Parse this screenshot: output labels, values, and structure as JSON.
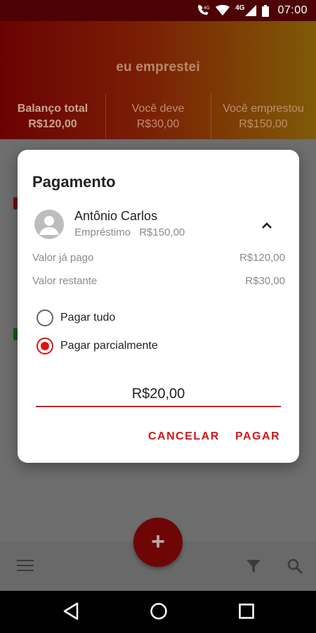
{
  "status_bar": {
    "time": "07:00",
    "network_badge": "4G",
    "icons": [
      "wifi-calling-icon",
      "wifi-icon",
      "signal-icon",
      "battery-icon"
    ]
  },
  "app": {
    "title": "eu emprestei"
  },
  "summary": {
    "total": {
      "label": "Balanço total",
      "value": "R$120,00"
    },
    "owe": {
      "label": "Você deve",
      "value": "R$30,00"
    },
    "lent": {
      "label": "Você emprestou",
      "value": "R$150,00"
    }
  },
  "dialog": {
    "title": "Pagamento",
    "person": {
      "name": "Antônio Carlos",
      "type": "Empréstimo",
      "amount": "R$150,00"
    },
    "paid": {
      "label": "Valor já pago",
      "value": "R$120,00"
    },
    "remaining": {
      "label": "Valor restante",
      "value": "R$30,00"
    },
    "options": [
      {
        "label": "Pagar tudo",
        "checked": false
      },
      {
        "label": "Pagar parcialmente",
        "checked": true
      }
    ],
    "amount_value": "R$20,00",
    "cancel_label": "CANCELAR",
    "pay_label": "PAGAR"
  },
  "fab": {
    "label": "+"
  },
  "colors": {
    "accent": "#d81515",
    "header_start": "#6b0202",
    "header_end": "#7f5a07"
  }
}
